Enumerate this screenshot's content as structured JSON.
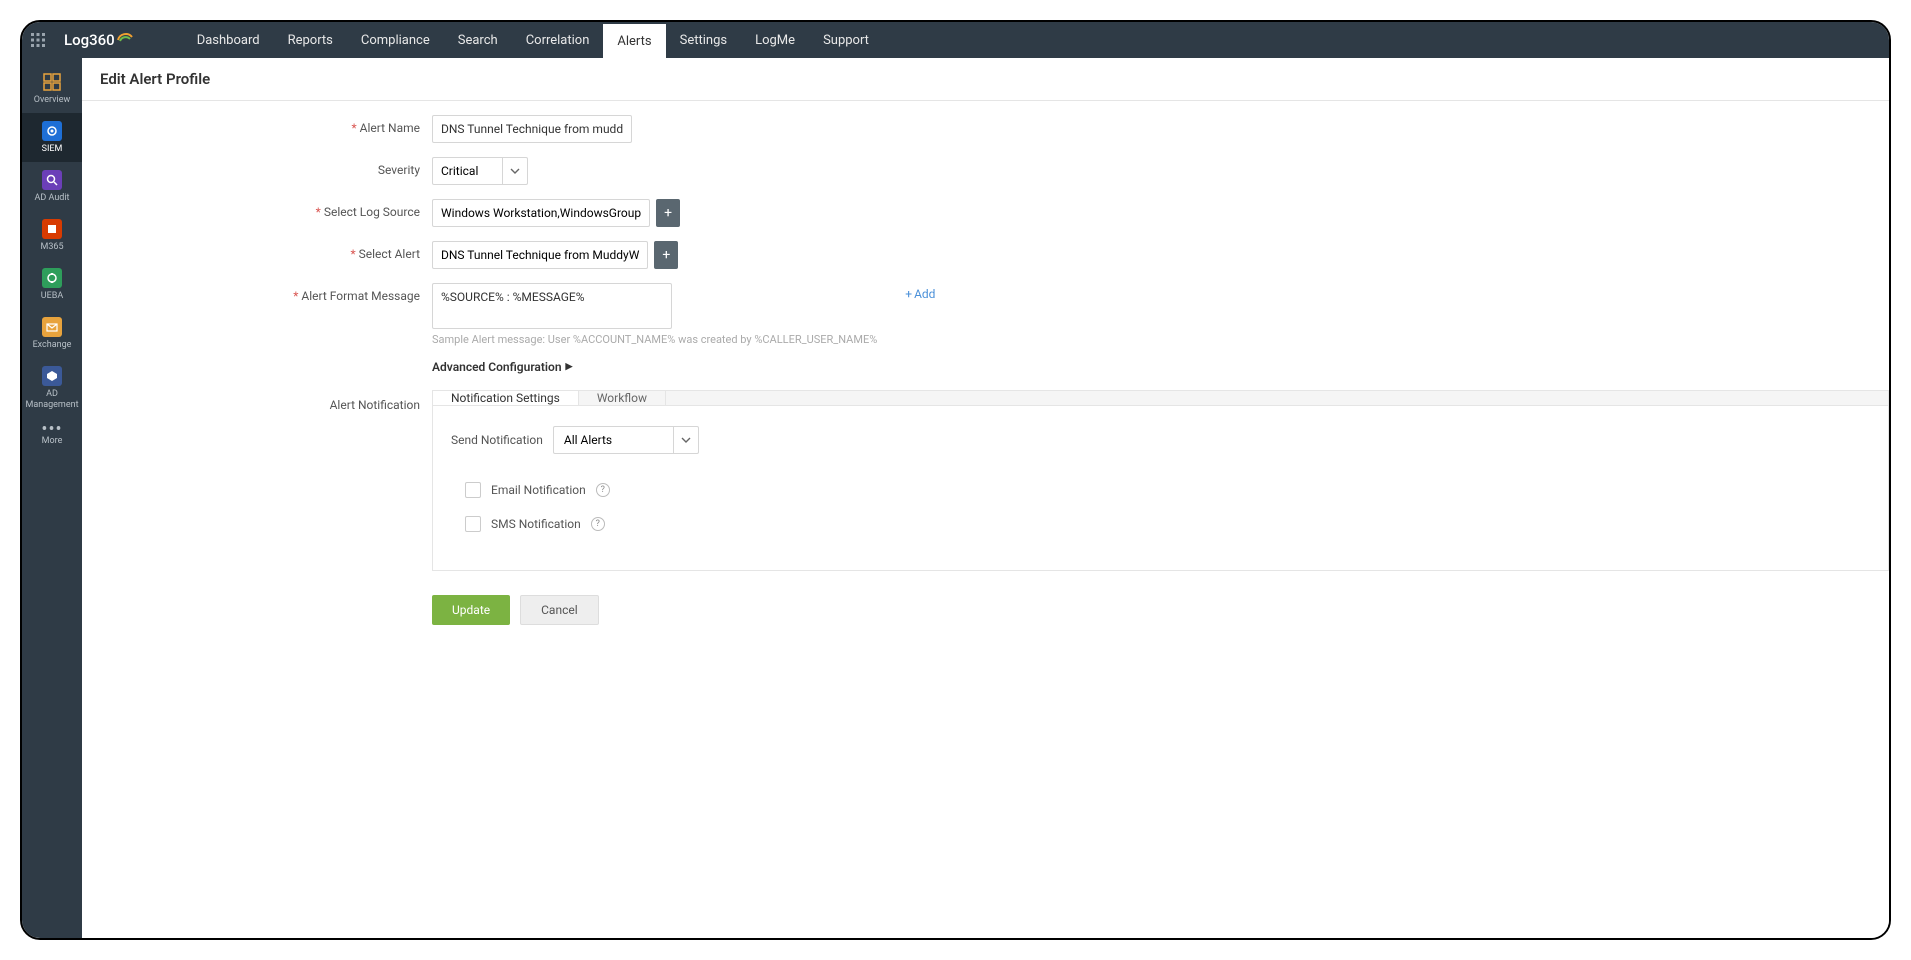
{
  "brand": "Log360",
  "nav": {
    "dashboard": "Dashboard",
    "reports": "Reports",
    "compliance": "Compliance",
    "search": "Search",
    "correlation": "Correlation",
    "alerts": "Alerts",
    "settings": "Settings",
    "logme": "LogMe",
    "support": "Support"
  },
  "sidebar": {
    "overview": "Overview",
    "siem": "SIEM",
    "adaudit": "AD Audit",
    "m365": "M365",
    "ueba": "UEBA",
    "exchange": "Exchange",
    "admgmt": "AD Management",
    "more": "More"
  },
  "page": {
    "title": "Edit Alert Profile"
  },
  "form": {
    "alert_name_label": "Alert Name",
    "alert_name_value": "DNS Tunnel Technique from muddy water",
    "severity_label": "Severity",
    "severity_value": "Critical",
    "log_source_label": "Select Log Source",
    "log_source_value": "Windows Workstation,WindowsGroup",
    "select_alert_label": "Select Alert",
    "select_alert_value": "DNS Tunnel Technique from MuddyW",
    "format_label": "Alert Format Message",
    "format_value": "%SOURCE% : %MESSAGE%",
    "add_link": "Add",
    "sample": "Sample Alert message: User %ACCOUNT_NAME% was created by %CALLER_USER_NAME%",
    "advanced": "Advanced Configuration",
    "notif_label": "Alert Notification"
  },
  "tabs": {
    "notif_settings": "Notification Settings",
    "workflow": "Workflow"
  },
  "notif": {
    "send_label": "Send Notification",
    "send_value": "All Alerts",
    "email": "Email Notification",
    "sms": "SMS Notification"
  },
  "actions": {
    "update": "Update",
    "cancel": "Cancel"
  }
}
